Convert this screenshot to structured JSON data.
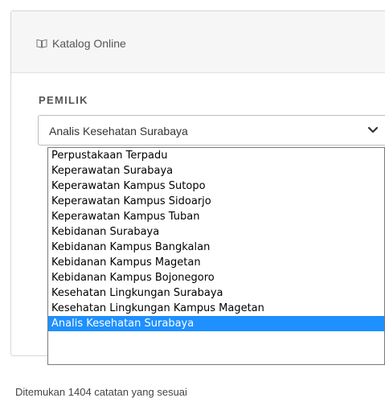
{
  "panel": {
    "title": "Katalog Online",
    "icon": "book-icon"
  },
  "field": {
    "label": "PEMILIK",
    "selected_value": "Analis Kesehatan Surabaya",
    "chevron_icon": "chevron-down-icon"
  },
  "dropdown": {
    "options": [
      "Perpustakaan Terpadu",
      "Keperawatan Surabaya",
      "Keperawatan Kampus Sutopo",
      "Keperawatan Kampus Sidoarjo",
      "Keperawatan Kampus Tuban",
      "Kebidanan Surabaya",
      "Kebidanan Kampus Bangkalan",
      "Kebidanan Kampus Magetan",
      "Kebidanan Kampus Bojonegoro",
      "Kesehatan Lingkungan Surabaya",
      "Kesehatan Lingkungan Kampus Magetan",
      "Analis Kesehatan Surabaya"
    ],
    "highlighted_index": 11,
    "highlight_color": "#1e90ff"
  },
  "footer": {
    "text": "Ditemukan 1404 catatan yang sesuai"
  }
}
